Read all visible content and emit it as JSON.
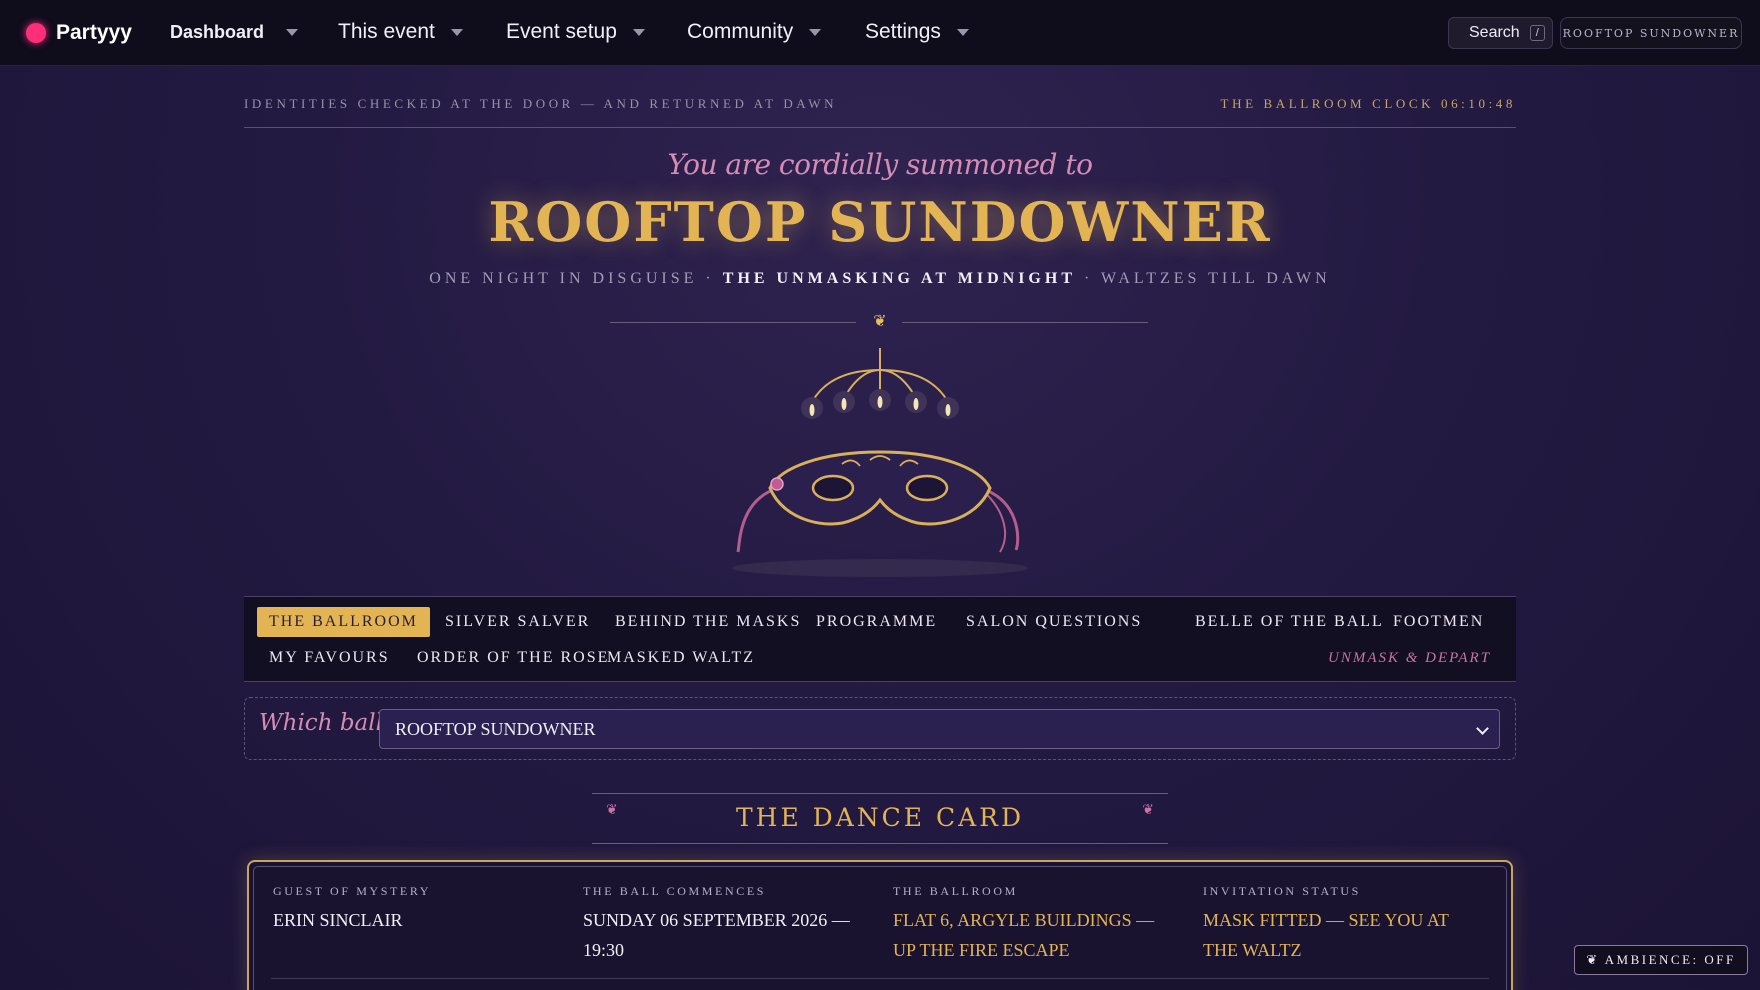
{
  "nav": {
    "brand": "Partyyy",
    "items": [
      {
        "label": "Dashboard"
      },
      {
        "label": "This event"
      },
      {
        "label": "Event setup"
      },
      {
        "label": "Community"
      },
      {
        "label": "Settings"
      }
    ],
    "search_label": "Search",
    "search_shortcut": "/",
    "event_pill": "ROOFTOP SUNDOWNER"
  },
  "strip": {
    "left": "IDENTITIES CHECKED AT THE DOOR — AND RETURNED AT DAWN",
    "right": "THE BALLROOM CLOCK 06:10:48"
  },
  "hero": {
    "summon": "You are cordially summoned to",
    "title": "ROOFTOP SUNDOWNER",
    "sub_a": "ONE NIGHT IN DISGUISE · ",
    "sub_b": "THE UNMASKING AT MIDNIGHT",
    "sub_c": " · WALTZES TILL DAWN",
    "flower": "❦"
  },
  "tabs": [
    {
      "label": "THE BALLROOM",
      "active": true
    },
    {
      "label": "SILVER SALVER"
    },
    {
      "label": "BEHIND THE MASKS"
    },
    {
      "label": "PROGRAMME"
    },
    {
      "label": "SALON QUESTIONS"
    },
    {
      "label": "BELLE OF THE BALL"
    },
    {
      "label": "FOOTMEN"
    },
    {
      "label": "MY FAVOURS"
    },
    {
      "label": "ORDER OF THE ROSE"
    },
    {
      "label": "MASKED WALTZ"
    },
    {
      "label": "UNMASK & DEPART"
    }
  ],
  "ball": {
    "label": "Which ball?",
    "selected": "ROOFTOP SUNDOWNER"
  },
  "dance_card": {
    "title": "THE DANCE CARD",
    "flower": "❦",
    "fields": [
      {
        "key": "GUEST OF MYSTERY",
        "value": "ERIN SINCLAIR"
      },
      {
        "key": "THE BALL COMMENCES",
        "value": "SUNDAY 06 SEPTEMBER 2026 — 19:30"
      },
      {
        "key": "THE BALLROOM",
        "value": "FLAT 6, ARGYLE BUILDINGS — UP THE FIRE ESCAPE"
      },
      {
        "key": "INVITATION STATUS",
        "value": "MASK FITTED — SEE YOU AT THE WALTZ"
      }
    ]
  },
  "ambience": "❦ AMBIENCE: OFF",
  "colors": {
    "gold": "#e2b454",
    "rose": "#d58bb4",
    "background": "#231a42",
    "brand_dot": "#ff2e7a"
  }
}
